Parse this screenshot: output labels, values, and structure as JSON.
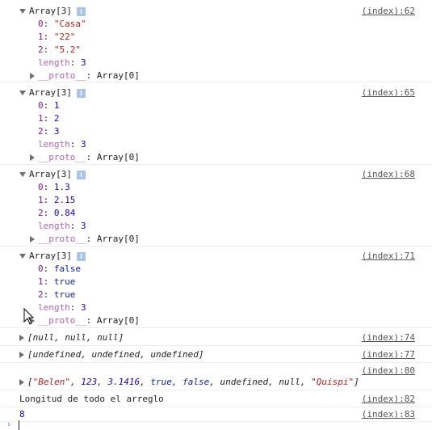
{
  "entries": [
    {
      "header": "Array[3]",
      "source": "(index):62",
      "items": [
        {
          "key": "0",
          "value": "\"Casa\"",
          "kind": "string"
        },
        {
          "key": "1",
          "value": "\"22\"",
          "kind": "string"
        },
        {
          "key": "2",
          "value": "\"5.2\"",
          "kind": "string"
        },
        {
          "key": "length",
          "value": "3",
          "kind": "number"
        }
      ],
      "proto_key": "__proto__",
      "proto_value": "Array[0]"
    },
    {
      "header": "Array[3]",
      "source": "(index):65",
      "items": [
        {
          "key": "0",
          "value": "1",
          "kind": "number"
        },
        {
          "key": "1",
          "value": "2",
          "kind": "number"
        },
        {
          "key": "2",
          "value": "3",
          "kind": "number"
        },
        {
          "key": "length",
          "value": "3",
          "kind": "number"
        }
      ],
      "proto_key": "__proto__",
      "proto_value": "Array[0]"
    },
    {
      "header": "Array[3]",
      "source": "(index):68",
      "items": [
        {
          "key": "0",
          "value": "1.3",
          "kind": "number"
        },
        {
          "key": "1",
          "value": "2.15",
          "kind": "number"
        },
        {
          "key": "2",
          "value": "0.84",
          "kind": "number"
        },
        {
          "key": "length",
          "value": "3",
          "kind": "number"
        }
      ],
      "proto_key": "__proto__",
      "proto_value": "Array[0]"
    },
    {
      "header": "Array[3]",
      "source": "(index):71",
      "items": [
        {
          "key": "0",
          "value": "false",
          "kind": "bool"
        },
        {
          "key": "1",
          "value": "true",
          "kind": "bool"
        },
        {
          "key": "2",
          "value": "true",
          "kind": "bool"
        },
        {
          "key": "length",
          "value": "3",
          "kind": "number"
        }
      ],
      "proto_key": "__proto__",
      "proto_value": "Array[0]"
    }
  ],
  "collapsed": [
    {
      "text": "[null, null, null]",
      "source": "(index):74"
    },
    {
      "text": "[undefined, undefined, undefined]",
      "source": "(index):77"
    }
  ],
  "mixed": {
    "source": "(index):80",
    "open": "[",
    "close": "]",
    "sep": ", ",
    "items": [
      {
        "v": "\"Belen\"",
        "kind": "string"
      },
      {
        "v": "123",
        "kind": "number"
      },
      {
        "v": "3.1416",
        "kind": "number"
      },
      {
        "v": "true",
        "kind": "bool"
      },
      {
        "v": "false",
        "kind": "bool"
      },
      {
        "v": "undefined",
        "kind": "plain"
      },
      {
        "v": "null",
        "kind": "plain"
      },
      {
        "v": "\"Quispi\"",
        "kind": "string"
      }
    ]
  },
  "log_line": {
    "text": "Longitud de todo el arreglo",
    "source": "(index):82"
  },
  "number_line": {
    "text": "8",
    "source": "(index):83"
  },
  "prompt": "›",
  "colors": {
    "string": "#c41a16",
    "number": "#1c00cf",
    "key": "#881391",
    "link": "#545454",
    "border": "#efefef"
  }
}
